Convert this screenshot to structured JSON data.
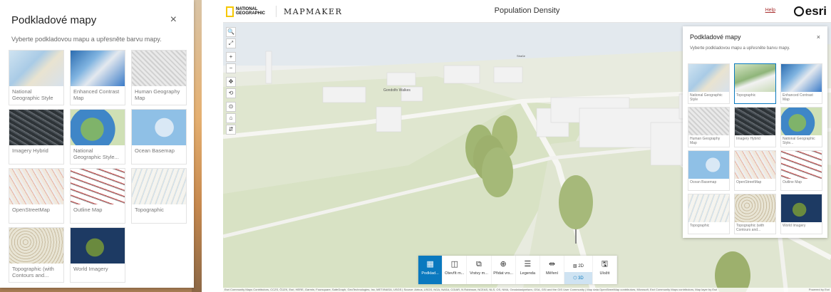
{
  "panel": {
    "title": "Podkladové mapy",
    "close": "×",
    "description": "Vyberte podkladovou mapu a upřesněte barvu mapy."
  },
  "left_cards": [
    {
      "label": "National Geographic Style",
      "thumb": "natgeo"
    },
    {
      "label": "Enhanced Contrast Map",
      "thumb": "contrast"
    },
    {
      "label": "Human Geography Map",
      "thumb": "human"
    },
    {
      "label": "Imagery Hybrid",
      "thumb": "hybrid"
    },
    {
      "label": "National Geographic Style...",
      "thumb": "natgeo2"
    },
    {
      "label": "Ocean Basemap",
      "thumb": "ocean"
    },
    {
      "label": "OpenStreetMap",
      "thumb": "osm"
    },
    {
      "label": "Outline Map",
      "thumb": "outline"
    },
    {
      "label": "Topographic",
      "thumb": "topo"
    },
    {
      "label": "Topographic (with Contours and...",
      "thumb": "topocontour"
    },
    {
      "label": "World Imagery",
      "thumb": "imagery"
    }
  ],
  "header": {
    "ng_text": "NATIONAL GEOGRAPHIC",
    "app_name": "MAPMAKER",
    "map_title": "Population Density",
    "help": "Help",
    "esri": "esri"
  },
  "scene_labels": {
    "label_a": "Gondolfo Walkes",
    "label_b": "Straße"
  },
  "nav_tools": [
    "🔍",
    "⤢",
    "+",
    "−",
    "✥",
    "⟲",
    "⊙",
    "⌂",
    "⇵"
  ],
  "right_panel": {
    "title": "Podkladové mapy",
    "close": "×",
    "description": "Vyberte podkladovou mapu a upřesněte barvu mapy."
  },
  "right_cards": [
    {
      "label": "National Geographic Style",
      "thumb": "natgeo",
      "selected": false
    },
    {
      "label": "Topographic",
      "thumb": "topo3d",
      "selected": true
    },
    {
      "label": "Enhanced Contrast Map",
      "thumb": "contrast",
      "selected": false
    },
    {
      "label": "Human Geography Map",
      "thumb": "human",
      "selected": false
    },
    {
      "label": "Imagery Hybrid",
      "thumb": "hybrid",
      "selected": false
    },
    {
      "label": "National Geographic Style...",
      "thumb": "natgeo2",
      "selected": false
    },
    {
      "label": "Ocean Basemap",
      "thumb": "ocean",
      "selected": false
    },
    {
      "label": "OpenStreetMap",
      "thumb": "osm",
      "selected": false
    },
    {
      "label": "Outline Map",
      "thumb": "outline",
      "selected": false
    },
    {
      "label": "Topographic",
      "thumb": "topo",
      "selected": false
    },
    {
      "label": "Topographic (with Contours and...",
      "thumb": "topocontour",
      "selected": false
    },
    {
      "label": "World Imagery",
      "thumb": "imagery",
      "selected": false
    }
  ],
  "toolbar": {
    "basemap": "Podklad...",
    "open": "Otevřít m...",
    "layers": "Vrstvy m...",
    "add": "Přidat vrs...",
    "legend": "Legenda",
    "measure": "Měření",
    "mode_2d": "2D",
    "mode_3d": "3D",
    "save": "Uložit"
  },
  "attribution": "Esri Community Maps Contributors, CCZS, ČÚZK, Esri, HERE, Garmin, Foursquare, SafeGraph, GeoTechnologies, Inc, METI/NASA, USGS | Source: Airbus, USGS, NGA, NASA, CGIAR, N Robinson, NCEAS, NLS, OS, NMA, Geodatastyrelsen, GSA, GSI and the GIS User Community | Map data OpenStreetMap contributors, Microsoft, Esri Community Maps contributors, Map layer by Esri",
  "powered": "Powered by Esri",
  "colors": {
    "accent": "#0a79bf",
    "ng_yellow": "#f6c800"
  }
}
